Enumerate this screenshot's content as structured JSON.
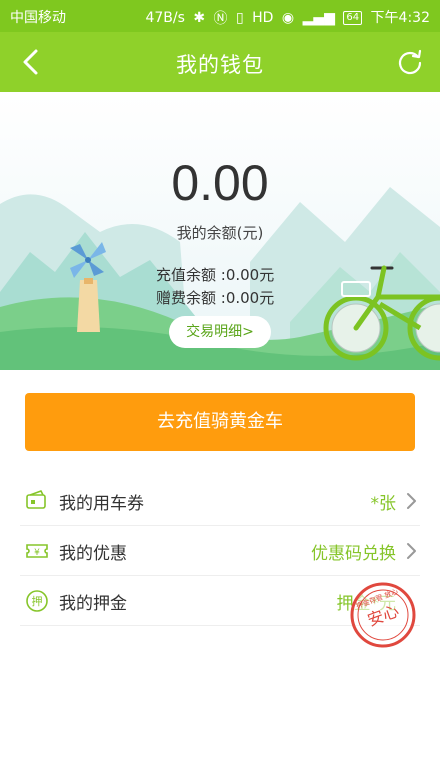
{
  "status_bar": {
    "carrier": "中国移动",
    "speed": "47B/s",
    "battery": "64",
    "time": "下午4:32"
  },
  "header": {
    "title": "我的钱包",
    "back_icon": "chevron-left-icon",
    "refresh_icon": "refresh-icon"
  },
  "wallet": {
    "balance": "0.00",
    "balance_label": "我的余额(元)",
    "recharge_balance": "充值余额 :0.00元",
    "bonus_balance": "赠费余额 :0.00元",
    "transactions_button": "交易明细>"
  },
  "recharge_button": "去充值骑黄金车",
  "menu": [
    {
      "label": "我的用车券",
      "value": "*张",
      "icon": "ticket-icon"
    },
    {
      "label": "我的优惠",
      "value": "优惠码兑换",
      "icon": "coupon-icon"
    },
    {
      "label": "我的押金",
      "value": "押金*元",
      "icon": "deposit-icon"
    }
  ],
  "stamp": {
    "text": "安心",
    "ring_text": "押金存管 放心"
  },
  "colors": {
    "primary": "#8fd12a",
    "accent": "#ff9c0d",
    "value_text": "#86c52a"
  }
}
